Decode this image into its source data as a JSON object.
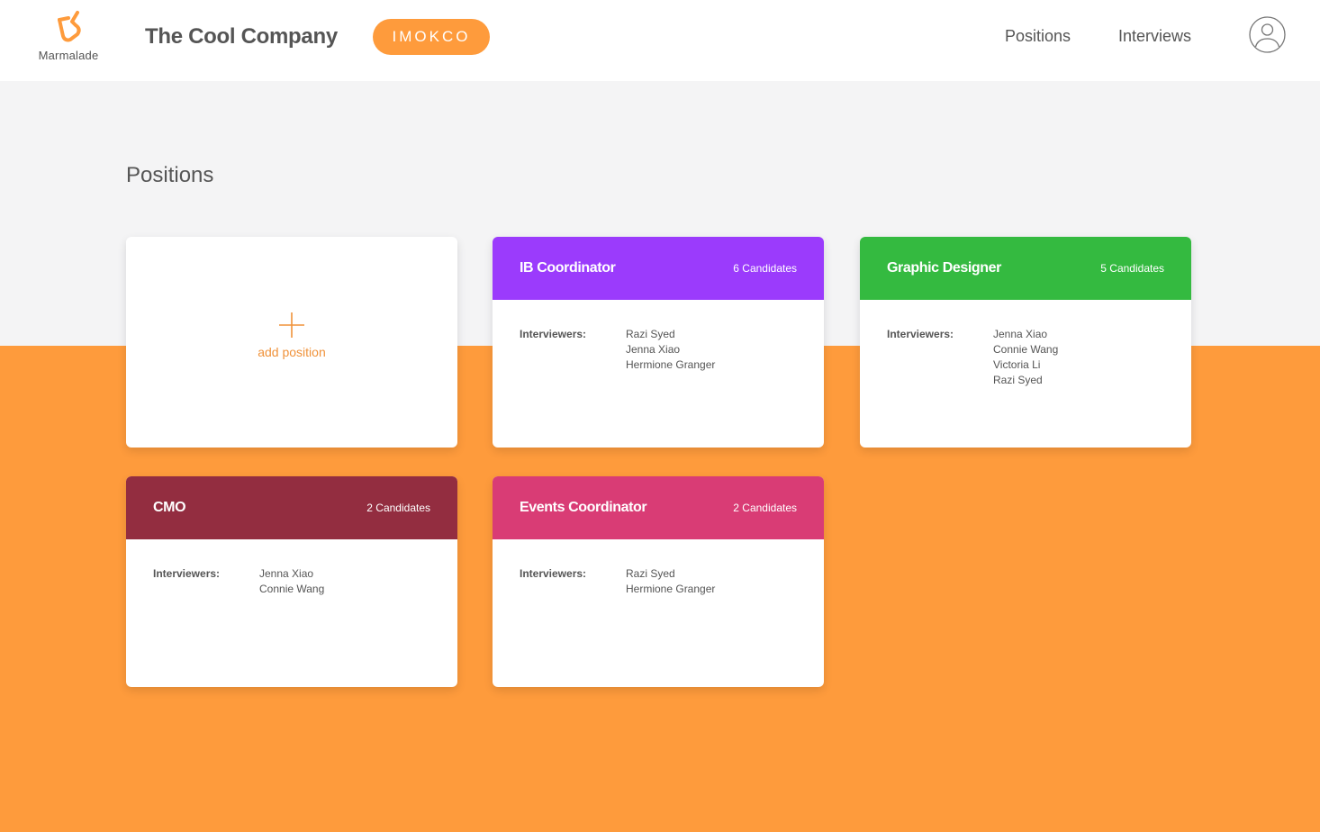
{
  "header": {
    "logo_text": "Marmalade",
    "company_name": "The Cool Company",
    "company_badge": "IMOKCO",
    "nav": {
      "positions": "Positions",
      "interviews": "Interviews"
    },
    "avatar_icon": "user-circle-icon"
  },
  "colors": {
    "accent": "#fe9b3c",
    "background": "#f4f4f5"
  },
  "page": {
    "title": "Positions",
    "add_label": "add position",
    "interviewers_label": "Interviewers:"
  },
  "positions": [
    {
      "title": "IB Coordinator",
      "candidates": "6 Candidates",
      "color": "#9b3bfc",
      "interviewers": [
        "Razi Syed",
        "Jenna Xiao",
        "Hermione Granger"
      ]
    },
    {
      "title": "Graphic Designer",
      "candidates": "5 Candidates",
      "color": "#34ba40",
      "interviewers": [
        "Jenna Xiao",
        "Connie Wang",
        "Victoria Li",
        "Razi Syed"
      ]
    },
    {
      "title": "CMO",
      "candidates": "2 Candidates",
      "color": "#932d40",
      "interviewers": [
        "Jenna Xiao",
        "Connie Wang"
      ]
    },
    {
      "title": "Events Coordinator",
      "candidates": "2 Candidates",
      "color": "#d93c75",
      "interviewers": [
        "Razi Syed",
        "Hermione Granger"
      ]
    }
  ]
}
